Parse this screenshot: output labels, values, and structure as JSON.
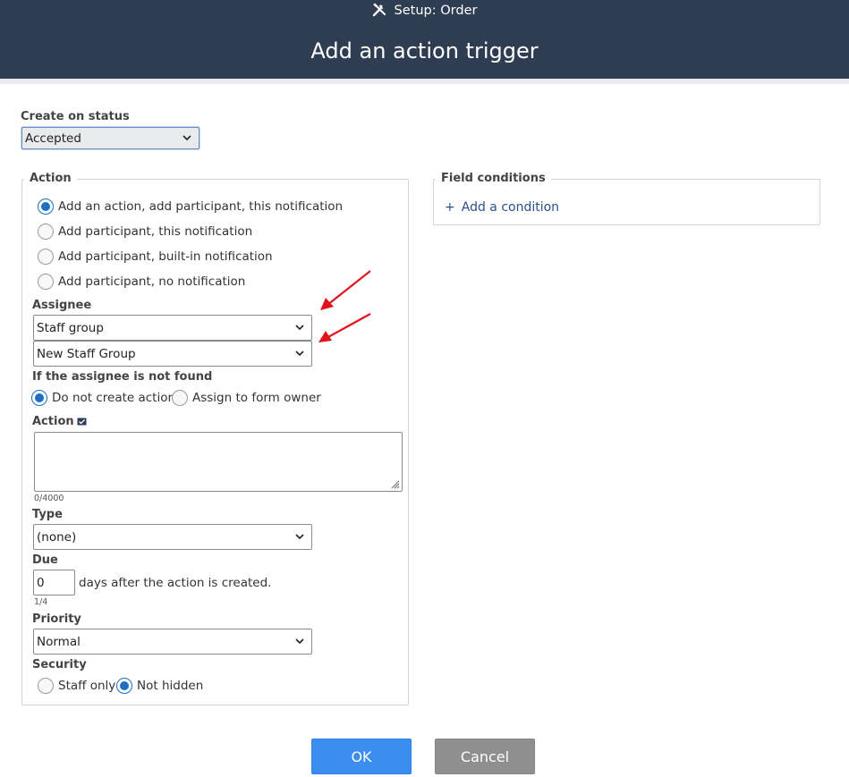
{
  "header": {
    "setup_label": "Setup: Order",
    "title": "Add an action trigger"
  },
  "create_on_status": {
    "label": "Create on status",
    "value": "Accepted"
  },
  "action_section": {
    "legend": "Action",
    "options": [
      {
        "label": "Add an action, add participant, this notification",
        "selected": true
      },
      {
        "label": "Add participant, this notification",
        "selected": false
      },
      {
        "label": "Add participant, built-in notification",
        "selected": false
      },
      {
        "label": "Add participant, no notification",
        "selected": false
      }
    ],
    "assignee": {
      "label": "Assignee",
      "type_value": "Staff group",
      "group_value": "New Staff Group"
    },
    "not_found": {
      "label": "If the assignee is not found",
      "options": [
        {
          "label": "Do not create action",
          "selected": true
        },
        {
          "label": "Assign to form owner",
          "selected": false
        }
      ]
    },
    "action_text": {
      "label": "Action",
      "value": "",
      "counter": "0/4000"
    },
    "type": {
      "label": "Type",
      "value": "(none)"
    },
    "due": {
      "label": "Due",
      "value": "0",
      "suffix": "days after the action is created.",
      "counter": "1/4"
    },
    "priority": {
      "label": "Priority",
      "value": "Normal"
    },
    "security": {
      "label": "Security",
      "options": [
        {
          "label": "Staff only",
          "selected": false
        },
        {
          "label": "Not hidden",
          "selected": true
        }
      ]
    }
  },
  "field_conditions": {
    "legend": "Field conditions",
    "add_label": "Add a condition"
  },
  "buttons": {
    "ok": "OK",
    "cancel": "Cancel"
  },
  "colors": {
    "header_bg": "#2e3d52",
    "radio_selected": "#1f6fc5",
    "ok_button": "#3b8ef0",
    "cancel_button": "#8f8f8f",
    "annotation_arrow": "#e0141e"
  }
}
